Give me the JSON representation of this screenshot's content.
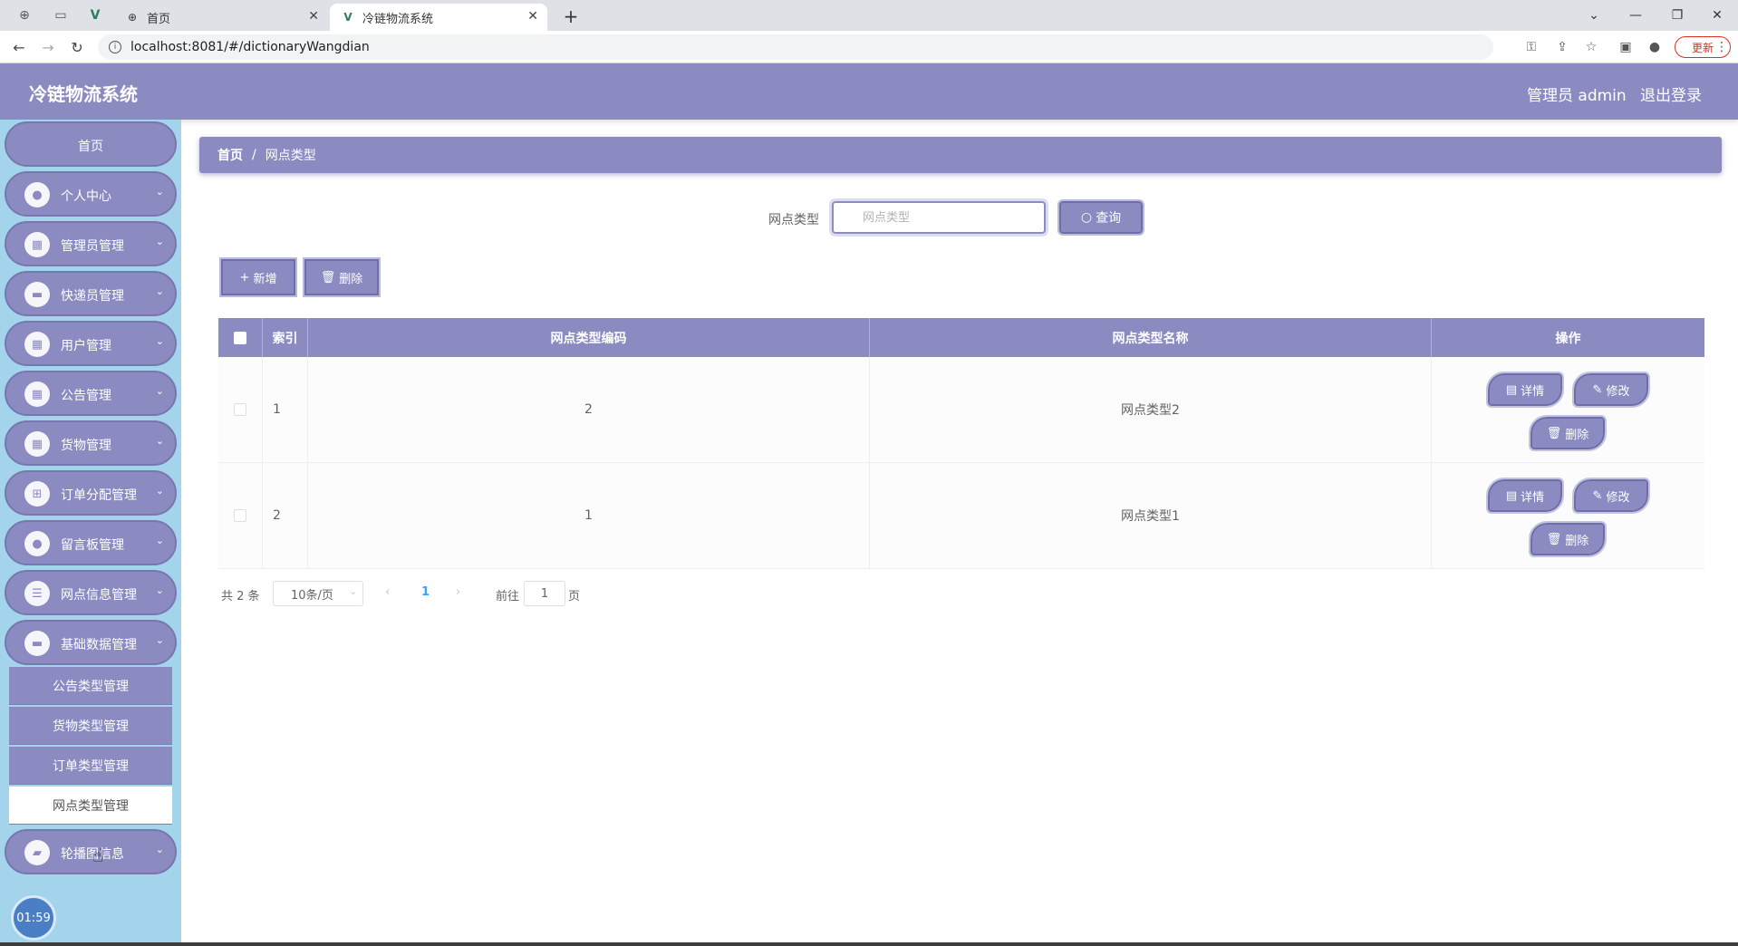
{
  "browser": {
    "tabs": [
      {
        "title": "首页",
        "active": false
      },
      {
        "title": "冷链物流系统",
        "active": true
      }
    ],
    "url": "localhost:8081/#/dictionaryWangdian",
    "update_label": "更新"
  },
  "header": {
    "title": "冷链物流系统",
    "user_label": "管理员 admin",
    "logout_label": "退出登录"
  },
  "sidebar": {
    "items": [
      {
        "label": "首页",
        "icon": "home"
      },
      {
        "label": "个人中心",
        "icon": "person-icon"
      },
      {
        "label": "管理员管理",
        "icon": "grid-icon"
      },
      {
        "label": "快递员管理",
        "icon": "monitor-icon"
      },
      {
        "label": "用户管理",
        "icon": "grid-icon"
      },
      {
        "label": "公告管理",
        "icon": "grid-icon"
      },
      {
        "label": "货物管理",
        "icon": "grid-icon"
      },
      {
        "label": "订单分配管理",
        "icon": "apps-icon"
      },
      {
        "label": "留言板管理",
        "icon": "person-icon"
      },
      {
        "label": "网点信息管理",
        "icon": "sliders-icon"
      },
      {
        "label": "基础数据管理",
        "icon": "monitor-icon"
      },
      {
        "label": "轮播图信息",
        "icon": "briefcase-icon"
      }
    ],
    "submenu": [
      {
        "label": "公告类型管理",
        "active": false
      },
      {
        "label": "货物类型管理",
        "active": false
      },
      {
        "label": "订单类型管理",
        "active": false
      },
      {
        "label": "网点类型管理",
        "active": true
      }
    ],
    "clock": "01:59"
  },
  "breadcrumb": {
    "home": "首页",
    "separator": "/",
    "current": "网点类型"
  },
  "search": {
    "label": "网点类型",
    "placeholder": "网点类型",
    "value": "",
    "button_label": "查询"
  },
  "actions": {
    "add_label": "新增",
    "delete_label": "删除"
  },
  "table": {
    "columns": [
      "索引",
      "网点类型编码",
      "网点类型名称",
      "操作"
    ],
    "rows": [
      {
        "index": "1",
        "code": "2",
        "name": "网点类型2"
      },
      {
        "index": "2",
        "code": "1",
        "name": "网点类型1"
      }
    ],
    "row_actions": {
      "detail": "详情",
      "edit": "修改",
      "delete": "删除"
    }
  },
  "pagination": {
    "total_text": "共 2 条",
    "page_size": "10条/页",
    "current_page": "1",
    "goto_label": "前往",
    "goto_value": "1",
    "page_unit": "页"
  },
  "colors": {
    "primary": "#8b8bc1",
    "sidebar_bg": "#a4d4ec",
    "accent_blue": "#409eff"
  }
}
